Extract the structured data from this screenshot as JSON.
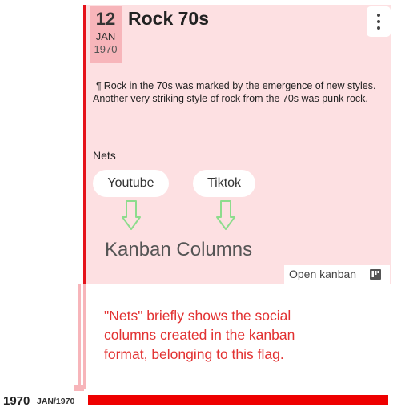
{
  "flag": {
    "date": {
      "day": "12",
      "month": "JAN",
      "year": "1970"
    },
    "title": "Rock 70s",
    "description": "Rock in the 70s was marked by the emergence of new styles. Another very striking style of rock from the 70s was punk rock.",
    "pilcrow": "¶",
    "nets_label": "Nets",
    "nets": [
      {
        "label": "Youtube"
      },
      {
        "label": "Tiktok"
      }
    ],
    "open_kanban_label": "Open kanban"
  },
  "annotation": {
    "caption": "Kanban Columns",
    "explanation": "\"Nets\" briefly shows the social columns created in the kanban format, belonging to this flag."
  },
  "timeline": {
    "year": "1970",
    "date": "JAN/1970"
  },
  "colors": {
    "card_background": "#fde0e2",
    "accent_red": "#e5121a",
    "date_badge": "#f7b5ba",
    "annotation_text": "#e23232",
    "arrow_green": "#8ddc8d",
    "timeline_bar": "#ee0000"
  },
  "icons": [
    "more-vertical-icon",
    "kanban-board-icon",
    "down-arrow-icon"
  ]
}
